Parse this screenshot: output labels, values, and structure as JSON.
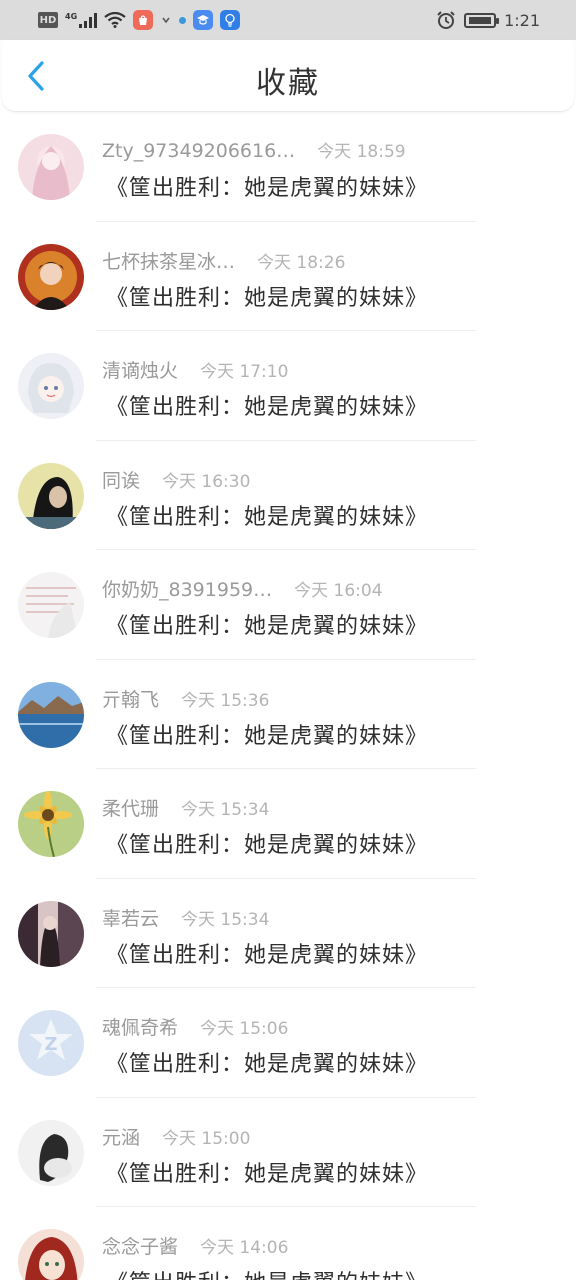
{
  "status_bar": {
    "hd": "HD",
    "network": "4G",
    "time": "1:21",
    "app_icons": [
      "shopping-app-icon",
      "blue-app-icon",
      "education-app-icon",
      "lightbulb-app-icon"
    ]
  },
  "header": {
    "back_icon": "chevron-left-icon",
    "title": "收藏"
  },
  "colors": {
    "accent": "#2aa1e8",
    "status_bar_bg": "#dcdcdc",
    "name_text": "#9a9a9a",
    "time_text": "#b4b4b4"
  },
  "items": [
    {
      "name": "Zty_97349206616…",
      "time": "今天  18:59",
      "message": "《筐出胜利：她是虎翼的妹妹》"
    },
    {
      "name": "七杯抹茶星冰…",
      "time": "今天  18:26",
      "message": "《筐出胜利：她是虎翼的妹妹》"
    },
    {
      "name": "清谪烛火",
      "time": "今天  17:10",
      "message": "《筐出胜利：她是虎翼的妹妹》"
    },
    {
      "name": "同诶",
      "time": "今天  16:30",
      "message": "《筐出胜利：她是虎翼的妹妹》"
    },
    {
      "name": "你奶奶_8391959…",
      "time": "今天  16:04",
      "message": "《筐出胜利：她是虎翼的妹妹》"
    },
    {
      "name": "亓翰飞",
      "time": "今天  15:36",
      "message": "《筐出胜利：她是虎翼的妹妹》"
    },
    {
      "name": "柔代珊",
      "time": "今天  15:34",
      "message": "《筐出胜利：她是虎翼的妹妹》"
    },
    {
      "name": "辜若云",
      "time": "今天  15:34",
      "message": "《筐出胜利：她是虎翼的妹妹》"
    },
    {
      "name": "魂佩奇希",
      "time": "今天  15:06",
      "message": "《筐出胜利：她是虎翼的妹妹》"
    },
    {
      "name": "元涵",
      "time": "今天  15:00",
      "message": "《筐出胜利：她是虎翼的妹妹》"
    },
    {
      "name": "念念子酱",
      "time": "今天  14:06",
      "message": "《筐出胜利：她是虎翼的妹妹》"
    }
  ]
}
